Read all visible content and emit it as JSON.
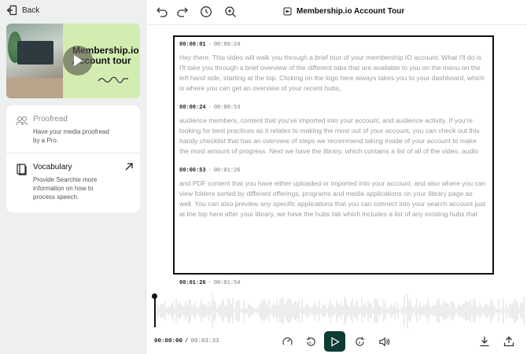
{
  "sidebar": {
    "back_label": "Back",
    "thumbnail": {
      "title_line1": "Membership.io",
      "title_line2": "Account tour"
    },
    "options": [
      {
        "title": "Proofread",
        "description": "Have your media proofread by a Pro.",
        "icon": "proofread-icon"
      },
      {
        "title": "Vocabulary",
        "description": "Provide Searchie more information on how to process speech.",
        "icon": "vocabulary-icon"
      }
    ]
  },
  "header": {
    "title": "Membership.io Account Tour",
    "icons": [
      "undo-icon",
      "redo-icon",
      "history-icon",
      "search-zoom-icon",
      "document-icon"
    ]
  },
  "transcript": {
    "segments": [
      {
        "start": "00:00:01",
        "end": "00:00:24",
        "text": "Hey there. This video will walk you through a brief tour of your membership IO account. What I'll do is I'll take you through a brief overview of the different tabs that are available to you on the menu on the left hand side, starting at the top. Clicking on the logo here always takes you to your dashboard, which is where you can get an overview of your recent hubs,"
      },
      {
        "start": "00:00:24",
        "end": "00:00:53",
        "text": "audience members, content that you've imported into your account, and audience activity. If you're looking for best practices as it relates to making the most out of your account, you can check out this handy checklist that has an overview of steps we recommend taking inside of your account to make the most amount of progress. Next we have the library, which contains a list of all of the video, audio"
      },
      {
        "start": "00:00:53",
        "end": "00:01:26",
        "text": "and PDF content that you have either uploaded or imported into your account, and also where you can view folders sorted by different offerings, programs and media applications on your library page as well. You can also preview any specific applications that you can connect into your search account just at the top here after your library, we have the hubs tab which includes a list of any existing hubs that"
      }
    ],
    "next_segment": {
      "start": "00:01:26",
      "end": "00:01:54"
    },
    "separator": "-"
  },
  "player": {
    "current_time": "00:00:00",
    "separator": "/",
    "duration": "00:03:33",
    "progress_fraction": 0,
    "controls": [
      "speed-icon",
      "rewind-icon",
      "play-icon",
      "forward-icon",
      "volume-icon",
      "download-icon",
      "share-icon"
    ],
    "accent_color": "#0e3b34"
  }
}
